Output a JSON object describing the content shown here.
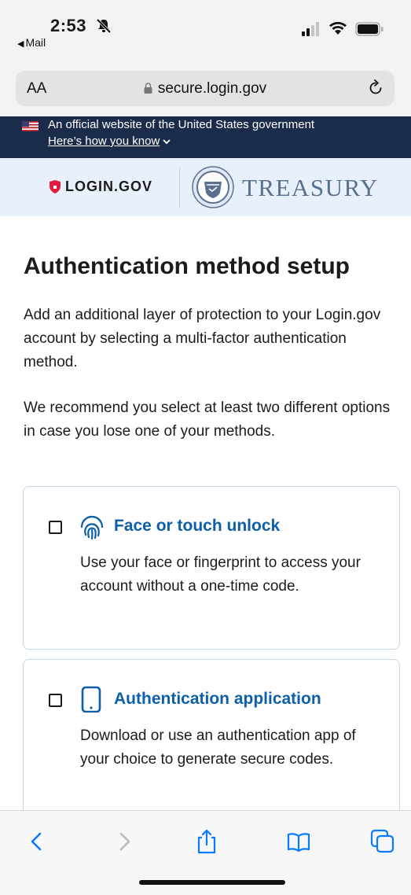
{
  "status_bar": {
    "time": "2:53",
    "back_app": "Mail"
  },
  "browser": {
    "text_size_label": "AA",
    "url": "secure.login.gov"
  },
  "gov_banner": {
    "official_text": "An official website of the United States government",
    "how_you_know": "Here’s how you know"
  },
  "logos": {
    "login_text": "LOGIN.GOV",
    "treasury_text": "TREASURY",
    "shield_color": "#e21c3d",
    "treasury_color": "#5b6f90"
  },
  "main": {
    "title": "Authentication method setup",
    "intro": "Add an additional layer of protection to your Login.gov account by selecting a multi-factor authentication method.",
    "recommend": "We recommend you select at least two different options in case you lose one of your methods.",
    "options": [
      {
        "title": "Face or touch unlock",
        "description": "Use your face or fingerprint to access your account without a one-time code.",
        "icon": "fingerprint-icon",
        "checked": false
      },
      {
        "title": "Authentication application",
        "description": "Download or use an authentication app of your choice to generate secure codes.",
        "icon": "phone-icon",
        "checked": false
      }
    ]
  },
  "toolbar": {
    "icons": [
      "back-icon",
      "forward-icon",
      "share-icon",
      "bookmarks-icon",
      "tabs-icon"
    ],
    "accent_color": "#0a7aff"
  }
}
